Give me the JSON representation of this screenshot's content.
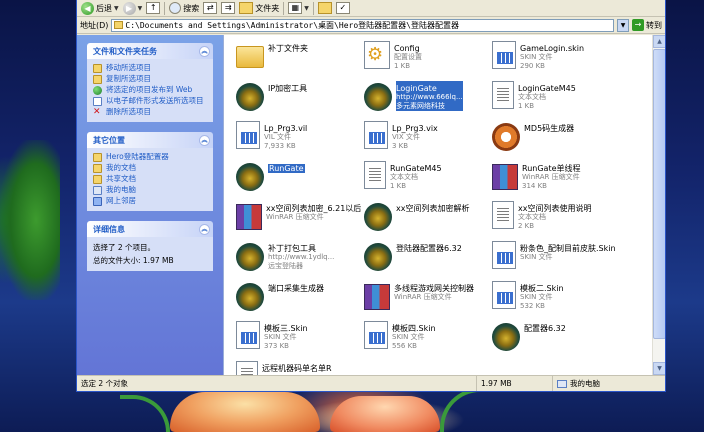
{
  "toolbar": {
    "back_label": "后退",
    "search_label": "搜索",
    "folders_label": "文件夹"
  },
  "address": {
    "label": "地址(D)",
    "path": "C:\\Documents and Settings\\Administrator\\桌面\\Hero登陆器配置器\\登陆器配置器",
    "go_label": "转到"
  },
  "tasks_panel": {
    "title": "文件和文件夹任务",
    "items": [
      "移动所选项目",
      "复制所选项目",
      "将选定的项目发布到 Web",
      "以电子邮件形式发送所选项目",
      "删除所选项目"
    ]
  },
  "places_panel": {
    "title": "其它位置",
    "items": [
      "Hero登陆器配置器",
      "我的文档",
      "共享文档",
      "我的电脑",
      "网上邻居"
    ]
  },
  "details_panel": {
    "title": "详细信息",
    "line1": "选择了 2 个项目。",
    "line2": "总的文件大小: 1.97 MB"
  },
  "files": [
    {
      "name": "补丁文件夹",
      "sub1": "",
      "sub2": "",
      "icon": "folder"
    },
    {
      "name": "Config",
      "sub1": "配置设置",
      "sub2": "1 KB",
      "icon": "cfg"
    },
    {
      "name": "GameLogin.skin",
      "sub1": "SKIN 文件",
      "sub2": "290 KB",
      "icon": "skin"
    },
    {
      "name": "IP加密工具",
      "sub1": "",
      "sub2": "",
      "icon": "app"
    },
    {
      "name": "LoginGate",
      "sub1": "http://www.666lq...",
      "sub2": "多元素网络科技",
      "icon": "app",
      "selected": true
    },
    {
      "name": "LoginGateM45",
      "sub1": "文本文档",
      "sub2": "1 KB",
      "icon": "txt"
    },
    {
      "name": "Lp_Prg3.vil",
      "sub1": "VIL 文件",
      "sub2": "7,933 KB",
      "icon": "skin"
    },
    {
      "name": "Lp_Prg3.vix",
      "sub1": "VIX 文件",
      "sub2": "3 KB",
      "icon": "skin"
    },
    {
      "name": "MD5码生成器",
      "sub1": "",
      "sub2": "",
      "icon": "lic"
    },
    {
      "name": "RunGate",
      "sub1": "",
      "sub2": "",
      "icon": "app",
      "selected": true
    },
    {
      "name": "RunGateM45",
      "sub1": "文本文档",
      "sub2": "1 KB",
      "icon": "txt"
    },
    {
      "name": "RunGate单线程",
      "sub1": "WinRAR 压缩文件",
      "sub2": "314 KB",
      "icon": "rar"
    },
    {
      "name": "xx空间列表加密_6.21以后",
      "sub1": "WinRAR 压缩文件",
      "sub2": "",
      "icon": "rar"
    },
    {
      "name": "xx空间列表加密解析",
      "sub1": "",
      "sub2": "",
      "icon": "app"
    },
    {
      "name": "xx空间列表使用说明",
      "sub1": "文本文档",
      "sub2": "2 KB",
      "icon": "txt"
    },
    {
      "name": "补丁打包工具",
      "sub1": "http://www.1ydlq...",
      "sub2": "远宝登陆器",
      "icon": "app"
    },
    {
      "name": "登陆器配置器6.32",
      "sub1": "",
      "sub2": "",
      "icon": "app"
    },
    {
      "name": "粉条色_配制目前皮肤.Skin",
      "sub1": "SKIN 文件",
      "sub2": "",
      "icon": "skin"
    },
    {
      "name": "端口采集生成器",
      "sub1": "",
      "sub2": "",
      "icon": "app"
    },
    {
      "name": "多线程游戏网关控制器",
      "sub1": "WinRAR 压缩文件",
      "sub2": "",
      "icon": "rar"
    },
    {
      "name": "模板二.Skin",
      "sub1": "SKIN 文件",
      "sub2": "532 KB",
      "icon": "skin"
    },
    {
      "name": "模板三.Skin",
      "sub1": "SKIN 文件",
      "sub2": "373 KB",
      "icon": "skin"
    },
    {
      "name": "模板四.Skin",
      "sub1": "SKIN 文件",
      "sub2": "556 KB",
      "icon": "skin"
    },
    {
      "name": "配置器6.32",
      "sub1": "",
      "sub2": "",
      "icon": "app"
    },
    {
      "name": "远程机器码单名单R",
      "sub1": "",
      "sub2": "",
      "icon": "txt"
    }
  ],
  "status": {
    "selection": "选定 2 个对象",
    "size": "1.97 MB",
    "location": "我的电脑"
  }
}
